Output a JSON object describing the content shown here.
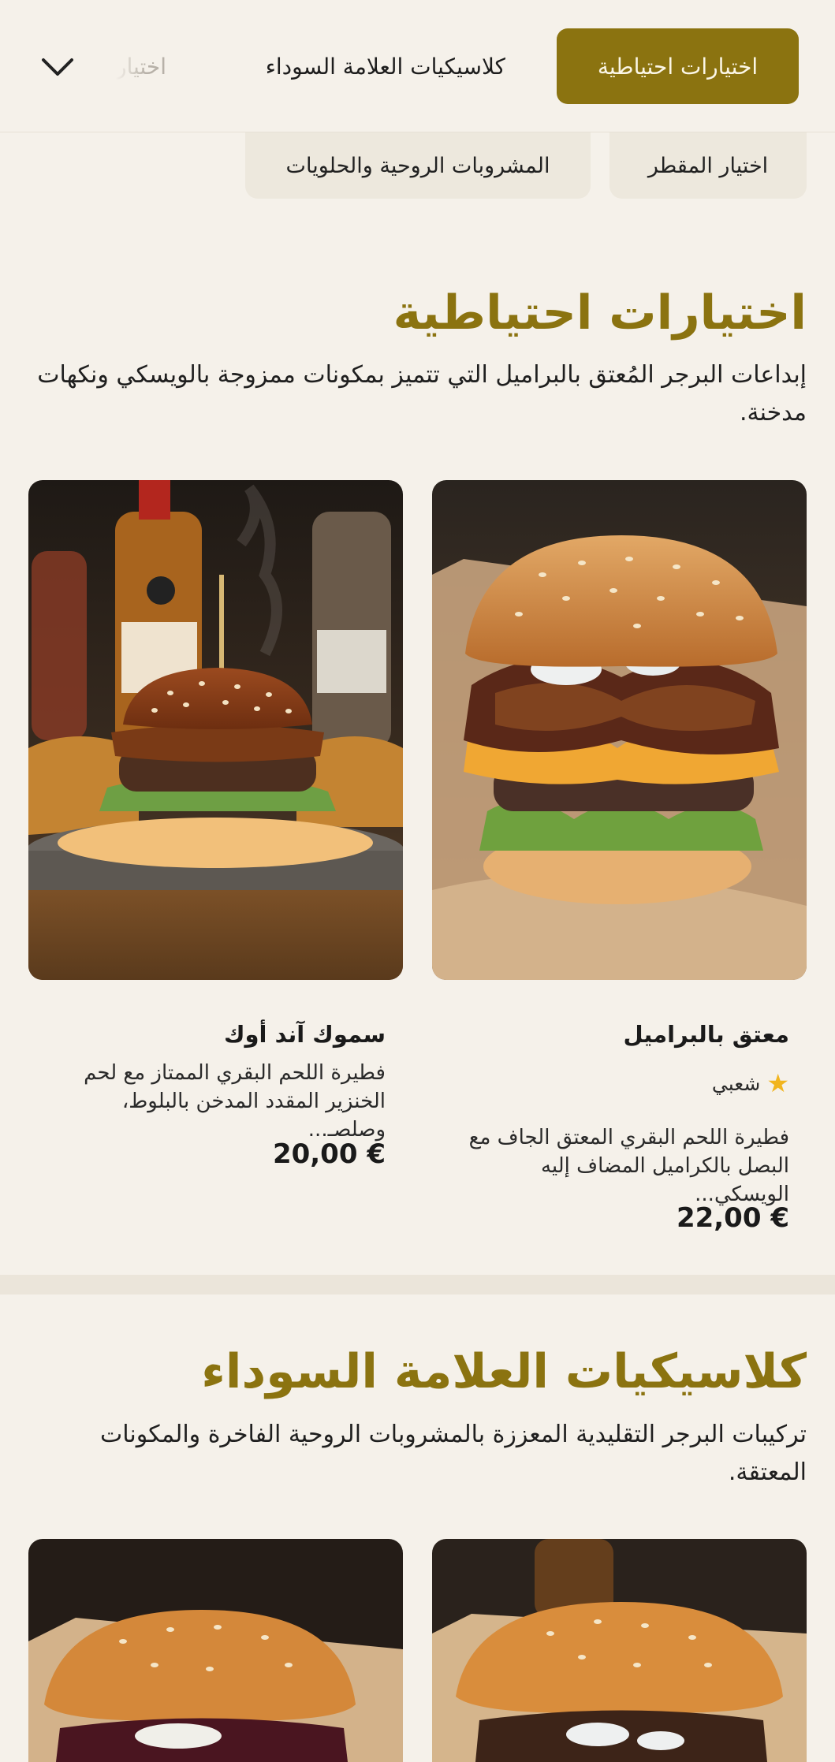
{
  "nav": {
    "active_category": "اختيارات احتياطية",
    "categories": [
      "كلاسيكيات العلامة السوداء",
      "اختيار"
    ],
    "chips": [
      "اختيار المقطر",
      "المشروبات الروحية والحلويات"
    ],
    "expand_icon": "chevron-down-icon"
  },
  "sections": [
    {
      "title": "اختيارات احتياطية",
      "description": "إبداعات البرجر المُعتق بالبراميل التي تتميز بمكونات ممزوجة بالويسكي ونكهات مدخنة.",
      "items": [
        {
          "name": "معتق بالبراميل",
          "badge": "شعبي",
          "badge_icon": "star-icon",
          "description": "فطيرة اللحم البقري المعتق الجاف مع البصل بالكراميل المضاف إليه الويسكي...",
          "price": "22,00 €"
        },
        {
          "name": "سموك آند أوك",
          "description": "فطيرة اللحم البقري الممتاز مع لحم الخنزير المقدد المدخن بالبلوط، وصلصـ...",
          "price": "20,00 €"
        }
      ]
    },
    {
      "title": "كلاسيكيات العلامة السوداء",
      "description": "تركيبات البرجر التقليدية المعززة بالمشروبات الروحية الفاخرة والمكونات المعتقة."
    }
  ],
  "colors": {
    "accent": "#8b7310",
    "background": "#f5f1ea",
    "chip": "#ede8dd",
    "star": "#f1b51f"
  }
}
